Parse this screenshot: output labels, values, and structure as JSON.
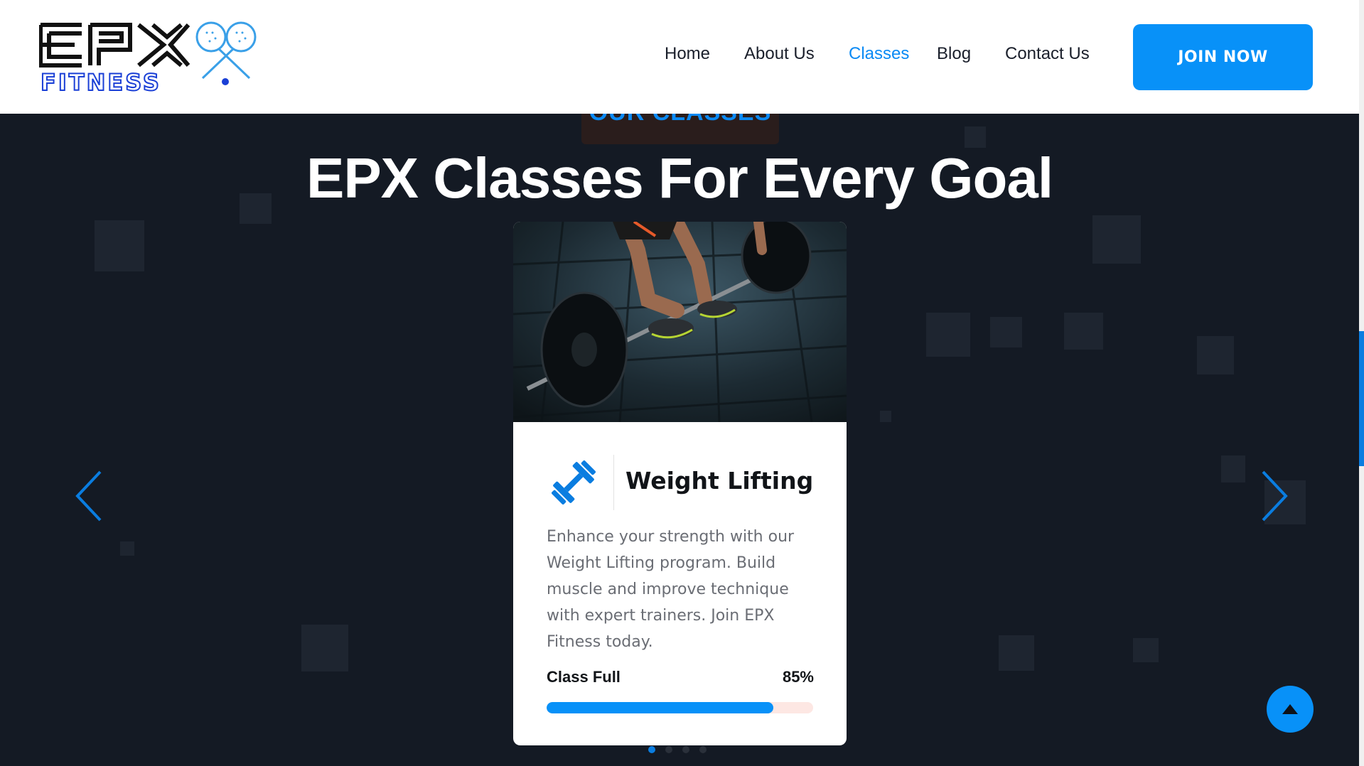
{
  "header": {
    "logo_text": "EPX",
    "logo_subtext": "FITNESS",
    "nav": [
      {
        "label": "Home",
        "active": false
      },
      {
        "label": "About Us",
        "active": false
      },
      {
        "label": "Classes",
        "active": true
      },
      {
        "label": "Blog",
        "active": false
      },
      {
        "label": "Contact Us",
        "active": false
      }
    ],
    "join_label": "JOIN NOW"
  },
  "section": {
    "eyebrow": "OUR CLASSES",
    "title": "EPX Classes For Every Goal"
  },
  "card": {
    "icon": "dumbbell-icon",
    "title": "Weight Lifting",
    "description": "Enhance your strength with our Weight Lifting program. Build muscle and improve technique with expert trainers. Join EPX Fitness today.",
    "progress_label": "Class Full",
    "progress_value": "85%",
    "progress_fraction": 0.85
  },
  "carousel": {
    "slide_count": 4,
    "active_index": 0
  },
  "colors": {
    "accent": "#0891f8",
    "background": "#141a24",
    "progress_track": "#fde7e3"
  }
}
